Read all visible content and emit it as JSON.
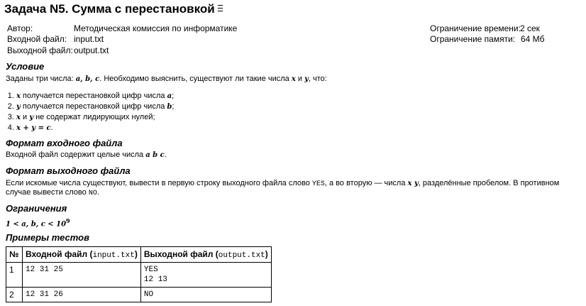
{
  "problem": {
    "title": "Задача N5. Сумма с перестановкой",
    "menu_icon": "menu-icon"
  },
  "meta": {
    "author_label": "Автор:",
    "author": "Методическая комиссия по информатике",
    "input_label": "Входной файл:",
    "input_file": "input.txt",
    "output_label": "Выходной файл:",
    "output_file": "output.txt",
    "time_label": "Ограничение времени:",
    "time_value": "2 сек",
    "memory_label": "Ограничение памяти:",
    "memory_value": "64 Мб"
  },
  "statement": {
    "heading": "Условие",
    "text_before": "Заданы три числа: ",
    "vars_abc": "a, b, c",
    "text_middle": ". Необходимо выяснить, существуют ли такие числа ",
    "var_x": "x",
    "and_word": " и ",
    "var_y": "y",
    "text_after": ", что:",
    "items": [
      {
        "var": "x",
        "text": " получается перестановкой цифр числа ",
        "num": "a",
        "end": ";"
      },
      {
        "var": "y",
        "text": " получается перестановкой цифр числа ",
        "num": "b",
        "end": ";"
      },
      {
        "var": "x",
        "mid": " и ",
        "var2": "y",
        "text": " не содержат лидирующих нулей;"
      },
      {
        "formula": "x + y = c",
        "end": "."
      }
    ]
  },
  "input_format": {
    "heading": "Формат входного файла",
    "text": "Входной файл содержит целые числа ",
    "vars": "a b c",
    "end": "."
  },
  "output_format": {
    "heading": "Формат выходного файла",
    "line1_a": "Если искомые числа существуют, вывести в первую строку выходного файла слово ",
    "yes": "YES",
    "line1_b": ", а во вторую — числа ",
    "vars": "x y",
    "line1_c": ", разделённые пробелом. В противном",
    "line2_a": "случае вывести слово ",
    "no": "NO",
    "line2_b": "."
  },
  "constraints": {
    "heading": "Ограничения",
    "formula": "1 < a, b, c < 10",
    "exp": "9"
  },
  "examples": {
    "heading": "Примеры тестов",
    "col_num": "№",
    "col_in": "Входной файл (",
    "col_in_file": "input.txt",
    "col_out": "Выходной файл (",
    "col_out_file": "output.txt",
    "close_paren": ")",
    "rows": [
      {
        "n": "1",
        "input": "12 31 25",
        "output": "YES\n12 13"
      },
      {
        "n": "2",
        "input": "12 31 26",
        "output": "NO"
      }
    ]
  }
}
